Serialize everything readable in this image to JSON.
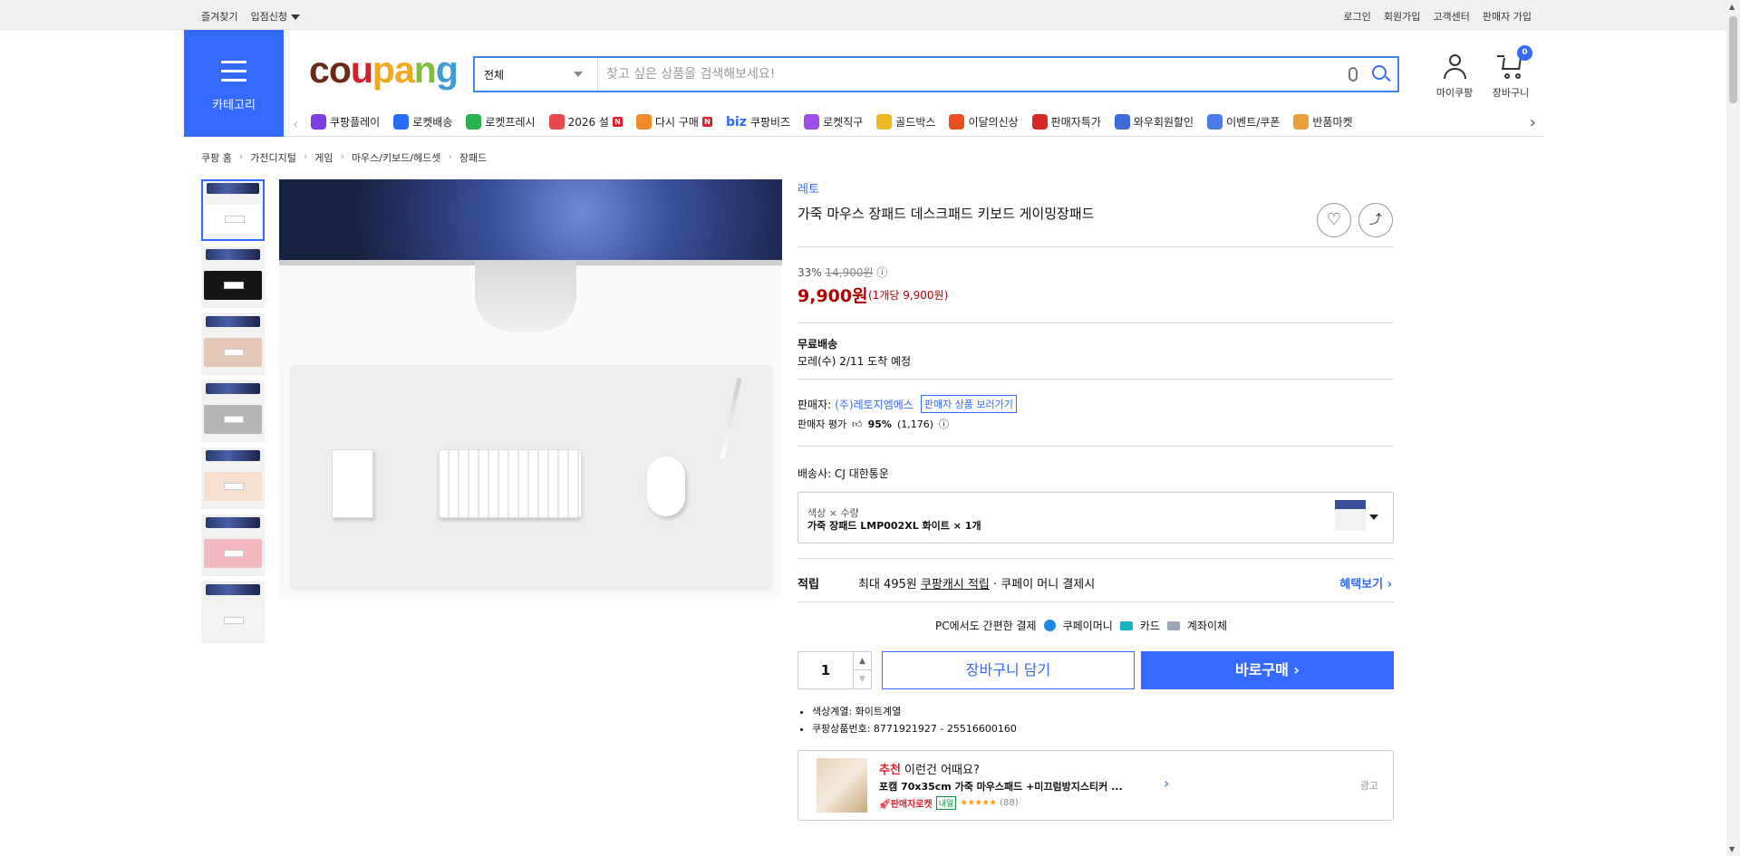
{
  "topbar": {
    "left": [
      "즐겨찾기",
      "입점신청"
    ],
    "right": [
      "로그인",
      "회원가입",
      "고객센터",
      "판매자 가입"
    ]
  },
  "category_label": "카테고리",
  "logo": {
    "letters": [
      "c",
      "o",
      "u",
      "p",
      "a",
      "n",
      "g"
    ],
    "colors": [
      "#6b2c17",
      "#6b2c17",
      "#d3202e",
      "#f0a81e",
      "#f0a81e",
      "#80bd42",
      "#3e9ed4"
    ]
  },
  "search": {
    "scope": "전체",
    "placeholder": "찾고 싶은 상품을 검색해보세요!"
  },
  "header": {
    "mycoupang": "마이쿠팡",
    "cart": "장바구니",
    "cart_count": "0"
  },
  "nav": [
    {
      "label": "쿠팡플레이",
      "color": "#7b3fe4"
    },
    {
      "label": "로켓배송",
      "color": "#2a6bff"
    },
    {
      "label": "로켓프레시",
      "color": "#2bb24c"
    },
    {
      "label": "2026 설",
      "color": "#e5484d",
      "badge": "N"
    },
    {
      "label": "다시 구매",
      "color": "#f28c28",
      "badge": "N"
    },
    {
      "label": "쿠팡비즈",
      "prefix": "biz",
      "color": "#2a6bff"
    },
    {
      "label": "로켓직구",
      "color": "#9b4de6"
    },
    {
      "label": "골드박스",
      "color": "#f2b824"
    },
    {
      "label": "이달의신상",
      "color": "#e8501f"
    },
    {
      "label": "판매자특가",
      "color": "#d92727"
    },
    {
      "label": "와우회원할인",
      "color": "#3f6ad8"
    },
    {
      "label": "이벤트/쿠폰",
      "color": "#4a7be8"
    },
    {
      "label": "반품마켓",
      "color": "#e8a03a"
    }
  ],
  "breadcrumb": [
    "쿠팡 홈",
    "가전디지털",
    "게임",
    "마우스/키보드/헤드셋",
    "장패드"
  ],
  "thumbs": [
    "#ffffff",
    "#151515",
    "#e4c7b4",
    "#b5b5b5",
    "#f7dfd0",
    "#f2b9c0",
    "#f4f4f4"
  ],
  "product": {
    "brand": "레토",
    "title": "가죽 마우스 장패드 데스크패드 키보드 게이밍장패드",
    "discount": "33%",
    "original_price": "14,900원",
    "price": "9,900원",
    "unit_price": "(1개당 9,900원)",
    "shipping": "무료배송",
    "arrival": "모레(수) 2/11 도착 예정",
    "seller_label": "판매자:",
    "seller_name": "(주)레토지엠에스",
    "seller_link": "판매자 상품 보러가기",
    "rating_label": "판매자 평가",
    "rating_pct": "95%",
    "rating_count": "(1,176)",
    "delivery": "배송사:  CJ 대한통운",
    "option_label": "색상 × 수량",
    "option_value": "가죽 장패드 LMP002XL 화이트 × 1개",
    "reward_key": "적립",
    "reward_prefix": "최대 495원 ",
    "reward_link": "쿠팡캐시 적립",
    "reward_suffix": " · 쿠페이 머니 결제시",
    "reward_more": "혜택보기 ›",
    "pcpay": "PC에서도 간편한 결제",
    "pay_methods": [
      "쿠페이머니",
      "카드",
      "계좌이체"
    ],
    "quantity": "1",
    "cart_button": "장바구니 담기",
    "buy_button": "바로구매 ›",
    "attrs": [
      "색상계열: 화이트계열",
      "쿠팡상품번호: 8771921927 - 25516600160"
    ]
  },
  "recommend": {
    "head_accent": "추천",
    "head": " 이런건 어때요?",
    "name": "포캠 70x35cm 가죽 마우스패드 +미끄럼방지스티커 ...",
    "rocket": "판매자로켓",
    "tomorrow": "내일",
    "stars": "★★★★★",
    "count": "(88)",
    "ad": "광고"
  }
}
